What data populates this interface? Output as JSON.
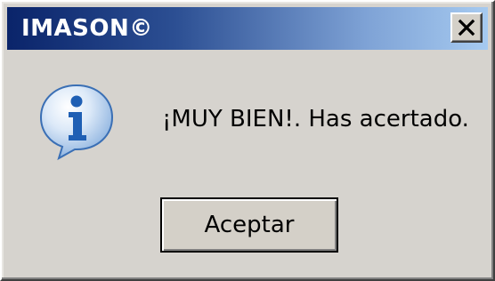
{
  "window": {
    "title": "IMASON©",
    "close_label": "close"
  },
  "dialog": {
    "icon": "info-icon",
    "message": "¡MUY BIEN!. Has acertado.",
    "ok_label": "Aceptar"
  },
  "colors": {
    "titlebar_start": "#0a246a",
    "titlebar_end": "#a6caf0",
    "dialog_bg": "#d6d3ce",
    "icon_blue": "#2f6fc0"
  }
}
